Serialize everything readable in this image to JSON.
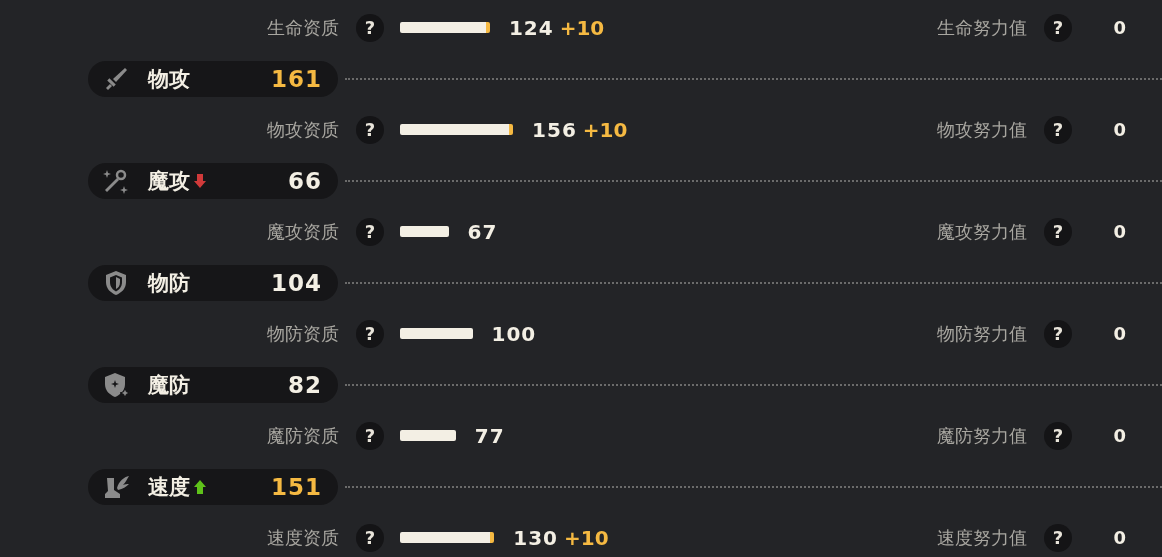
{
  "rows": [
    {
      "kind": "detail",
      "label": "生命资质",
      "help": "?",
      "value": "124",
      "bonus": "+10",
      "effort_label": "生命努力值",
      "effort_help": "?",
      "effort_value": "0"
    },
    {
      "kind": "header",
      "label": "物攻",
      "value": "161",
      "highlight": true,
      "raised": false,
      "lowered": false
    },
    {
      "kind": "detail",
      "label": "物攻资质",
      "help": "?",
      "value": "156",
      "bonus": "+10",
      "effort_label": "物攻努力值",
      "effort_help": "?",
      "effort_value": "0"
    },
    {
      "kind": "header",
      "label": "魔攻",
      "value": "66",
      "highlight": false,
      "raised": false,
      "lowered": true
    },
    {
      "kind": "detail",
      "label": "魔攻资质",
      "help": "?",
      "value": "67",
      "effort_label": "魔攻努力值",
      "effort_help": "?",
      "effort_value": "0"
    },
    {
      "kind": "header",
      "label": "物防",
      "value": "104",
      "highlight": false,
      "raised": false,
      "lowered": false
    },
    {
      "kind": "detail",
      "label": "物防资质",
      "help": "?",
      "value": "100",
      "effort_label": "物防努力值",
      "effort_help": "?",
      "effort_value": "0"
    },
    {
      "kind": "header",
      "label": "魔防",
      "value": "82",
      "highlight": false,
      "raised": false,
      "lowered": false
    },
    {
      "kind": "detail",
      "label": "魔防资质",
      "help": "?",
      "value": "77",
      "effort_label": "魔防努力值",
      "effort_help": "?",
      "effort_value": "0"
    },
    {
      "kind": "header",
      "label": "速度",
      "value": "151",
      "highlight": true,
      "raised": true,
      "lowered": false
    },
    {
      "kind": "detail",
      "label": "速度资质",
      "help": "?",
      "value": "130",
      "bonus": "+10",
      "effort_label": "速度努力值",
      "effort_help": "?",
      "effort_value": "0"
    }
  ]
}
